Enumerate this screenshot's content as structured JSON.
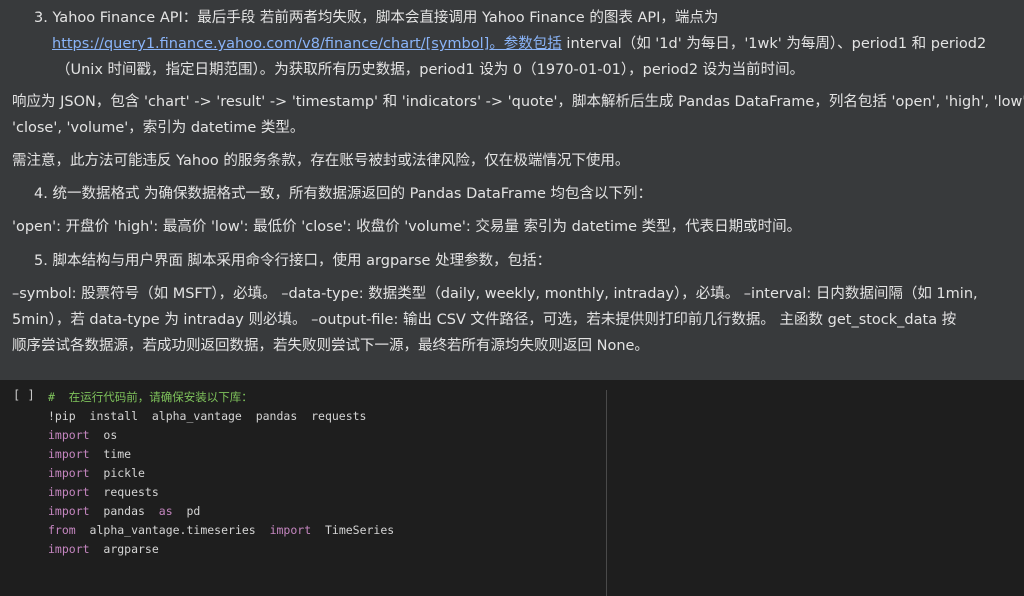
{
  "markdown": {
    "item3_prefix": "3. Yahoo Finance API：最后手段 若前两者均失败，脚本会直接调用 Yahoo Finance 的图表 API，端点为",
    "item3_link": "https://query1.finance.yahoo.com/v8/finance/chart/[symbol]",
    "item3_link_suffix": "。参数包括",
    "item3_line2_rest": " interval（如 '1d' 为每日，'1wk' 为每周）、period1 和 period2",
    "item3_line3": "（Unix 时间戳，指定日期范围）。为获取所有历史数据，period1 设为 0（1970-01-01），period2 设为当前时间。",
    "para_json_1": "响应为 JSON，包含 'chart' -> 'result' -> 'timestamp' 和 'indicators' -> 'quote'，脚本解析后生成 Pandas DataFrame，列名包括 'open', 'high', 'low',",
    "para_json_2": "'close', 'volume'，索引为 datetime 类型。",
    "para_tos": "需注意，此方法可能违反 Yahoo 的服务条款，存在账号被封或法律风险，仅在极端情况下使用。",
    "item4": "4. 统一数据格式 为确保数据格式一致，所有数据源返回的 Pandas DataFrame 均包含以下列：",
    "para_cols": "'open': 开盘价 'high': 最高价 'low': 最低价 'close': 收盘价 'volume': 交易量 索引为 datetime 类型，代表日期或时间。",
    "item5": "5. 脚本结构与用户界面 脚本采用命令行接口，使用 argparse 处理参数，包括：",
    "args_1": "–symbol: 股票符号（如 MSFT），必填。 –data-type: 数据类型（daily, weekly, monthly, intraday），必填。 –interval: 日内数据间隔（如 1min,",
    "args_2": "5min），若 data-type 为 intraday 则必填。 –output-file: 输出 CSV 文件路径，可选，若未提供则打印前几行数据。 主函数 get_stock_data 按",
    "args_3": "顺序尝试各数据源，若成功则返回数据，若失败则尝试下一源，最终若所有源均失败则返回 None。"
  },
  "code_cell": {
    "run_label": "[ ]",
    "lines": {
      "l0_comment": "#  在运行代码前，请确保安装以下库：",
      "l1": "!pip  install  alpha_vantage  pandas  requests",
      "l2_kw": "import",
      "l2_rest": "  os",
      "l3_kw": "import",
      "l3_rest": "  time",
      "l4_kw": "import",
      "l4_rest": "  pickle",
      "l5_kw": "import",
      "l5_rest": "  requests",
      "l6_kw": "import",
      "l6_mid": "  pandas  ",
      "l6_kw2": "as",
      "l6_rest": "  pd",
      "l7_kw": "from",
      "l7_mid": "  alpha_vantage.timeseries  ",
      "l7_kw2": "import",
      "l7_rest": "  TimeSeries",
      "l8_kw": "import",
      "l8_rest": "  argparse"
    }
  }
}
